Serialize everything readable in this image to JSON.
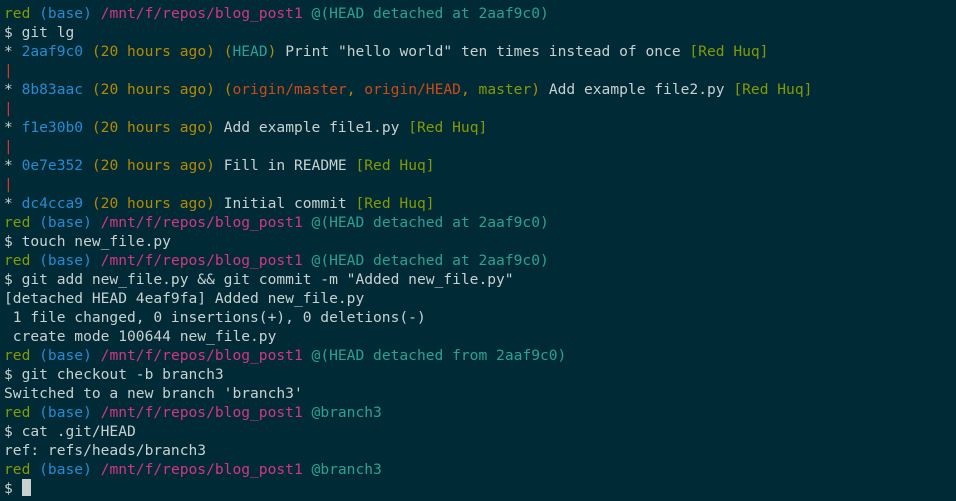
{
  "colors": {
    "background": "#002b36",
    "default": "#c8d0d0",
    "green": "#859900",
    "blue": "#268bd2",
    "magenta": "#d33682",
    "cyan": "#2aa198",
    "orange": "#cb4b16",
    "yellow": "#b58900",
    "red": "#dc322f"
  },
  "lines": [
    [
      {
        "t": "red",
        "c": "green"
      },
      {
        "t": " (base) ",
        "c": "blue"
      },
      {
        "t": "/mnt/f/repos/blog_post1",
        "c": "magenta"
      },
      {
        "t": " @(HEAD detached at 2aaf9c0)",
        "c": "cyan"
      }
    ],
    [
      {
        "t": "$ git lg",
        "c": "default"
      }
    ],
    [
      {
        "t": "* ",
        "c": "default"
      },
      {
        "t": "2aaf9c0",
        "c": "blue"
      },
      {
        "t": " (20 hours ago) ",
        "c": "yellow"
      },
      {
        "t": "(",
        "c": "yellow"
      },
      {
        "t": "HEAD",
        "c": "cyan"
      },
      {
        "t": ")",
        "c": "yellow"
      },
      {
        "t": " Print \"hello world\" ten times instead of once ",
        "c": "default"
      },
      {
        "t": "[Red Huq]",
        "c": "green"
      }
    ],
    [
      {
        "t": "|",
        "c": "red"
      }
    ],
    [
      {
        "t": "* ",
        "c": "default"
      },
      {
        "t": "8b83aac",
        "c": "blue"
      },
      {
        "t": " (20 hours ago) ",
        "c": "yellow"
      },
      {
        "t": "(",
        "c": "yellow"
      },
      {
        "t": "origin/master",
        "c": "orange"
      },
      {
        "t": ", ",
        "c": "yellow"
      },
      {
        "t": "origin/HEAD",
        "c": "orange"
      },
      {
        "t": ", ",
        "c": "yellow"
      },
      {
        "t": "master",
        "c": "green"
      },
      {
        "t": ")",
        "c": "yellow"
      },
      {
        "t": " Add example file2.py ",
        "c": "default"
      },
      {
        "t": "[Red Huq]",
        "c": "green"
      }
    ],
    [
      {
        "t": "|",
        "c": "red"
      }
    ],
    [
      {
        "t": "* ",
        "c": "default"
      },
      {
        "t": "f1e30b0",
        "c": "blue"
      },
      {
        "t": " (20 hours ago) ",
        "c": "yellow"
      },
      {
        "t": "Add example file1.py ",
        "c": "default"
      },
      {
        "t": "[Red Huq]",
        "c": "green"
      }
    ],
    [
      {
        "t": "|",
        "c": "red"
      }
    ],
    [
      {
        "t": "* ",
        "c": "default"
      },
      {
        "t": "0e7e352",
        "c": "blue"
      },
      {
        "t": " (20 hours ago) ",
        "c": "yellow"
      },
      {
        "t": "Fill in README ",
        "c": "default"
      },
      {
        "t": "[Red Huq]",
        "c": "green"
      }
    ],
    [
      {
        "t": "|",
        "c": "red"
      }
    ],
    [
      {
        "t": "* ",
        "c": "default"
      },
      {
        "t": "dc4cca9",
        "c": "blue"
      },
      {
        "t": " (20 hours ago) ",
        "c": "yellow"
      },
      {
        "t": "Initial commit ",
        "c": "default"
      },
      {
        "t": "[Red Huq]",
        "c": "green"
      }
    ],
    [
      {
        "t": "red",
        "c": "green"
      },
      {
        "t": " (base) ",
        "c": "blue"
      },
      {
        "t": "/mnt/f/repos/blog_post1",
        "c": "magenta"
      },
      {
        "t": " @(HEAD detached at 2aaf9c0)",
        "c": "cyan"
      }
    ],
    [
      {
        "t": "$ touch new_file.py",
        "c": "default"
      }
    ],
    [
      {
        "t": "red",
        "c": "green"
      },
      {
        "t": " (base) ",
        "c": "blue"
      },
      {
        "t": "/mnt/f/repos/blog_post1",
        "c": "magenta"
      },
      {
        "t": " @(HEAD detached at 2aaf9c0)",
        "c": "cyan"
      }
    ],
    [
      {
        "t": "$ git add new_file.py && git commit -m \"Added new_file.py\"",
        "c": "default"
      }
    ],
    [
      {
        "t": "[detached HEAD 4eaf9fa] Added new_file.py",
        "c": "default"
      }
    ],
    [
      {
        "t": " 1 file changed, 0 insertions(+), 0 deletions(-)",
        "c": "default"
      }
    ],
    [
      {
        "t": " create mode 100644 new_file.py",
        "c": "default"
      }
    ],
    [
      {
        "t": "red",
        "c": "green"
      },
      {
        "t": " (base) ",
        "c": "blue"
      },
      {
        "t": "/mnt/f/repos/blog_post1",
        "c": "magenta"
      },
      {
        "t": " @(HEAD detached from 2aaf9c0)",
        "c": "cyan"
      }
    ],
    [
      {
        "t": "$ git checkout -b branch3",
        "c": "default"
      }
    ],
    [
      {
        "t": "Switched to a new branch 'branch3'",
        "c": "default"
      }
    ],
    [
      {
        "t": "red",
        "c": "green"
      },
      {
        "t": " (base) ",
        "c": "blue"
      },
      {
        "t": "/mnt/f/repos/blog_post1",
        "c": "magenta"
      },
      {
        "t": " @branch3",
        "c": "cyan"
      }
    ],
    [
      {
        "t": "$ cat .git/HEAD",
        "c": "default"
      }
    ],
    [
      {
        "t": "ref: refs/heads/branch3",
        "c": "default"
      }
    ],
    [
      {
        "t": "red",
        "c": "green"
      },
      {
        "t": " (base) ",
        "c": "blue"
      },
      {
        "t": "/mnt/f/repos/blog_post1",
        "c": "magenta"
      },
      {
        "t": " @branch3",
        "c": "cyan"
      }
    ],
    [
      {
        "t": "$ ",
        "c": "default"
      }
    ]
  ]
}
